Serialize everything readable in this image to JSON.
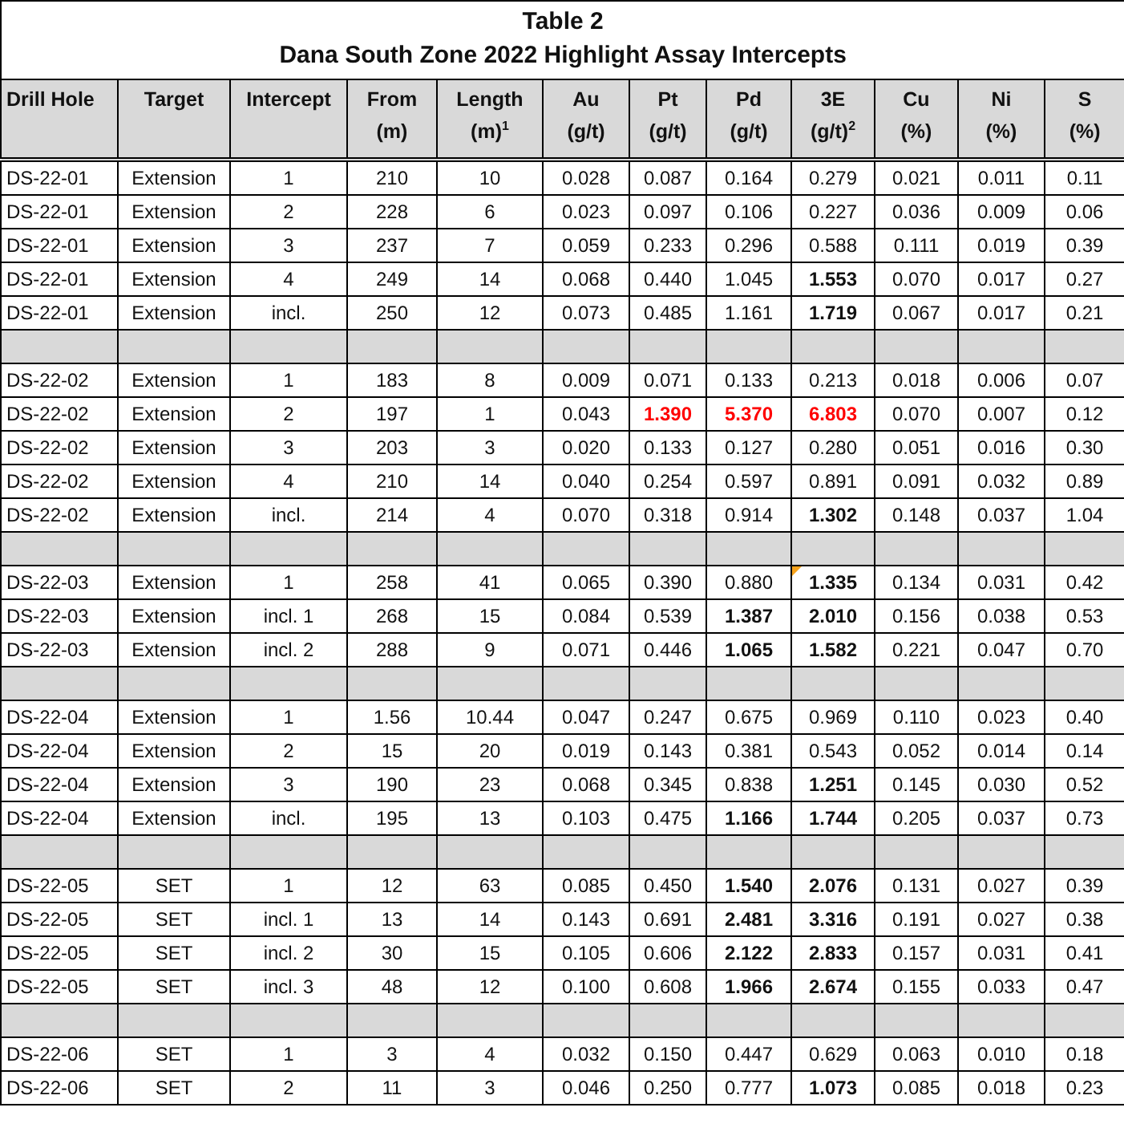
{
  "title": [
    "Table 2",
    "Dana South Zone 2022 Highlight Assay Intercepts"
  ],
  "columns": [
    {
      "name": "Drill Hole"
    },
    {
      "name": "Target"
    },
    {
      "name": "Intercept"
    },
    {
      "name": "From",
      "unit": "(m)"
    },
    {
      "name": "Length",
      "unit": "(m)$^{1}$"
    },
    {
      "name": "Au",
      "unit": "(g/t)"
    },
    {
      "name": "Pt",
      "unit": "(g/t)"
    },
    {
      "name": "Pd",
      "unit": "(g/t)"
    },
    {
      "name": "3E",
      "unit": "(g/t)$^{2}$"
    },
    {
      "name": "Cu",
      "unit": "(%)"
    },
    {
      "name": "Ni",
      "unit": "(%)"
    },
    {
      "name": "S",
      "unit": "(%)"
    }
  ],
  "rows": [
    {
      "kind": "data",
      "cells": [
        {
          "text": "DS-22-01"
        },
        {
          "text": "Extension"
        },
        {
          "text": "1"
        },
        {
          "text": "210"
        },
        {
          "text": "10"
        },
        {
          "text": "0.028"
        },
        {
          "text": "0.087"
        },
        {
          "text": "0.164"
        },
        {
          "text": "0.279"
        },
        {
          "text": "0.021"
        },
        {
          "text": "0.011"
        },
        {
          "text": "0.11"
        }
      ]
    },
    {
      "kind": "data",
      "cells": [
        {
          "text": "DS-22-01"
        },
        {
          "text": "Extension"
        },
        {
          "text": "2"
        },
        {
          "text": "228"
        },
        {
          "text": "6"
        },
        {
          "text": "0.023"
        },
        {
          "text": "0.097"
        },
        {
          "text": "0.106"
        },
        {
          "text": "0.227"
        },
        {
          "text": "0.036"
        },
        {
          "text": "0.009"
        },
        {
          "text": "0.06"
        }
      ]
    },
    {
      "kind": "data",
      "cells": [
        {
          "text": "DS-22-01"
        },
        {
          "text": "Extension"
        },
        {
          "text": "3"
        },
        {
          "text": "237"
        },
        {
          "text": "7"
        },
        {
          "text": "0.059"
        },
        {
          "text": "0.233"
        },
        {
          "text": "0.296"
        },
        {
          "text": "0.588"
        },
        {
          "text": "0.111"
        },
        {
          "text": "0.019"
        },
        {
          "text": "0.39"
        }
      ]
    },
    {
      "kind": "data",
      "cells": [
        {
          "text": "DS-22-01"
        },
        {
          "text": "Extension"
        },
        {
          "text": "4"
        },
        {
          "text": "249"
        },
        {
          "text": "14"
        },
        {
          "text": "0.068"
        },
        {
          "text": "0.440"
        },
        {
          "text": "1.045"
        },
        {
          "text": "1.553",
          "bold": true
        },
        {
          "text": "0.070"
        },
        {
          "text": "0.017"
        },
        {
          "text": "0.27"
        }
      ]
    },
    {
      "kind": "data",
      "cells": [
        {
          "text": "DS-22-01"
        },
        {
          "text": "Extension"
        },
        {
          "text": "incl."
        },
        {
          "text": "250"
        },
        {
          "text": "12"
        },
        {
          "text": "0.073"
        },
        {
          "text": "0.485"
        },
        {
          "text": "1.161"
        },
        {
          "text": "1.719",
          "bold": true
        },
        {
          "text": "0.067"
        },
        {
          "text": "0.017"
        },
        {
          "text": "0.21"
        }
      ]
    },
    {
      "kind": "spacer"
    },
    {
      "kind": "data",
      "cells": [
        {
          "text": "DS-22-02"
        },
        {
          "text": "Extension"
        },
        {
          "text": "1"
        },
        {
          "text": "183"
        },
        {
          "text": "8"
        },
        {
          "text": "0.009"
        },
        {
          "text": "0.071"
        },
        {
          "text": "0.133"
        },
        {
          "text": "0.213"
        },
        {
          "text": "0.018"
        },
        {
          "text": "0.006"
        },
        {
          "text": "0.07"
        }
      ]
    },
    {
      "kind": "data",
      "cells": [
        {
          "text": "DS-22-02"
        },
        {
          "text": "Extension"
        },
        {
          "text": "2"
        },
        {
          "text": "197"
        },
        {
          "text": "1"
        },
        {
          "text": "0.043"
        },
        {
          "text": "1.390",
          "bold": true,
          "red": true
        },
        {
          "text": "5.370",
          "bold": true,
          "red": true
        },
        {
          "text": "6.803",
          "bold": true,
          "red": true
        },
        {
          "text": "0.070"
        },
        {
          "text": "0.007"
        },
        {
          "text": "0.12"
        }
      ]
    },
    {
      "kind": "data",
      "cells": [
        {
          "text": "DS-22-02"
        },
        {
          "text": "Extension"
        },
        {
          "text": "3"
        },
        {
          "text": "203"
        },
        {
          "text": "3"
        },
        {
          "text": "0.020"
        },
        {
          "text": "0.133"
        },
        {
          "text": "0.127"
        },
        {
          "text": "0.280"
        },
        {
          "text": "0.051"
        },
        {
          "text": "0.016"
        },
        {
          "text": "0.30"
        }
      ]
    },
    {
      "kind": "data",
      "cells": [
        {
          "text": "DS-22-02"
        },
        {
          "text": "Extension"
        },
        {
          "text": "4"
        },
        {
          "text": "210"
        },
        {
          "text": "14"
        },
        {
          "text": "0.040"
        },
        {
          "text": "0.254"
        },
        {
          "text": "0.597"
        },
        {
          "text": "0.891"
        },
        {
          "text": "0.091"
        },
        {
          "text": "0.032"
        },
        {
          "text": "0.89"
        }
      ]
    },
    {
      "kind": "data",
      "cells": [
        {
          "text": "DS-22-02"
        },
        {
          "text": "Extension"
        },
        {
          "text": "incl."
        },
        {
          "text": "214"
        },
        {
          "text": "4"
        },
        {
          "text": "0.070"
        },
        {
          "text": "0.318"
        },
        {
          "text": "0.914"
        },
        {
          "text": "1.302",
          "bold": true
        },
        {
          "text": "0.148"
        },
        {
          "text": "0.037"
        },
        {
          "text": "1.04"
        }
      ]
    },
    {
      "kind": "spacer"
    },
    {
      "kind": "data",
      "cells": [
        {
          "text": "DS-22-03"
        },
        {
          "text": "Extension"
        },
        {
          "text": "1"
        },
        {
          "text": "258"
        },
        {
          "text": "41"
        },
        {
          "text": "0.065"
        },
        {
          "text": "0.390"
        },
        {
          "text": "0.880"
        },
        {
          "text": "1.335",
          "bold": true,
          "comment": true
        },
        {
          "text": "0.134"
        },
        {
          "text": "0.031"
        },
        {
          "text": "0.42"
        }
      ]
    },
    {
      "kind": "data",
      "cells": [
        {
          "text": "DS-22-03"
        },
        {
          "text": "Extension"
        },
        {
          "text": "incl. 1"
        },
        {
          "text": "268"
        },
        {
          "text": "15"
        },
        {
          "text": "0.084"
        },
        {
          "text": "0.539"
        },
        {
          "text": "1.387",
          "bold": true
        },
        {
          "text": "2.010",
          "bold": true
        },
        {
          "text": "0.156"
        },
        {
          "text": "0.038"
        },
        {
          "text": "0.53"
        }
      ]
    },
    {
      "kind": "data",
      "cells": [
        {
          "text": "DS-22-03"
        },
        {
          "text": "Extension"
        },
        {
          "text": "incl. 2"
        },
        {
          "text": "288"
        },
        {
          "text": "9"
        },
        {
          "text": "0.071"
        },
        {
          "text": "0.446"
        },
        {
          "text": "1.065",
          "bold": true
        },
        {
          "text": "1.582",
          "bold": true
        },
        {
          "text": "0.221"
        },
        {
          "text": "0.047"
        },
        {
          "text": "0.70"
        }
      ]
    },
    {
      "kind": "spacer"
    },
    {
      "kind": "data",
      "cells": [
        {
          "text": "DS-22-04"
        },
        {
          "text": "Extension"
        },
        {
          "text": "1"
        },
        {
          "text": "1.56"
        },
        {
          "text": "10.44"
        },
        {
          "text": "0.047"
        },
        {
          "text": "0.247"
        },
        {
          "text": "0.675"
        },
        {
          "text": "0.969"
        },
        {
          "text": "0.110"
        },
        {
          "text": "0.023"
        },
        {
          "text": "0.40"
        }
      ]
    },
    {
      "kind": "data",
      "cells": [
        {
          "text": "DS-22-04"
        },
        {
          "text": "Extension"
        },
        {
          "text": "2"
        },
        {
          "text": "15"
        },
        {
          "text": "20"
        },
        {
          "text": "0.019"
        },
        {
          "text": "0.143"
        },
        {
          "text": "0.381"
        },
        {
          "text": "0.543"
        },
        {
          "text": "0.052"
        },
        {
          "text": "0.014"
        },
        {
          "text": "0.14"
        }
      ]
    },
    {
      "kind": "data",
      "cells": [
        {
          "text": "DS-22-04"
        },
        {
          "text": "Extension"
        },
        {
          "text": "3"
        },
        {
          "text": "190"
        },
        {
          "text": "23"
        },
        {
          "text": "0.068"
        },
        {
          "text": "0.345"
        },
        {
          "text": "0.838"
        },
        {
          "text": "1.251",
          "bold": true
        },
        {
          "text": "0.145"
        },
        {
          "text": "0.030"
        },
        {
          "text": "0.52"
        }
      ]
    },
    {
      "kind": "data",
      "cells": [
        {
          "text": "DS-22-04"
        },
        {
          "text": "Extension"
        },
        {
          "text": "incl."
        },
        {
          "text": "195"
        },
        {
          "text": "13"
        },
        {
          "text": "0.103"
        },
        {
          "text": "0.475"
        },
        {
          "text": "1.166",
          "bold": true
        },
        {
          "text": "1.744",
          "bold": true
        },
        {
          "text": "0.205"
        },
        {
          "text": "0.037"
        },
        {
          "text": "0.73"
        }
      ]
    },
    {
      "kind": "spacer"
    },
    {
      "kind": "data",
      "cells": [
        {
          "text": "DS-22-05"
        },
        {
          "text": "SET"
        },
        {
          "text": "1"
        },
        {
          "text": "12"
        },
        {
          "text": "63"
        },
        {
          "text": "0.085"
        },
        {
          "text": "0.450"
        },
        {
          "text": "1.540",
          "bold": true
        },
        {
          "text": "2.076",
          "bold": true
        },
        {
          "text": "0.131"
        },
        {
          "text": "0.027"
        },
        {
          "text": "0.39"
        }
      ]
    },
    {
      "kind": "data",
      "cells": [
        {
          "text": "DS-22-05"
        },
        {
          "text": "SET"
        },
        {
          "text": "incl. 1"
        },
        {
          "text": "13"
        },
        {
          "text": "14"
        },
        {
          "text": "0.143"
        },
        {
          "text": "0.691"
        },
        {
          "text": "2.481",
          "bold": true
        },
        {
          "text": "3.316",
          "bold": true
        },
        {
          "text": "0.191"
        },
        {
          "text": "0.027"
        },
        {
          "text": "0.38"
        }
      ]
    },
    {
      "kind": "data",
      "cells": [
        {
          "text": "DS-22-05"
        },
        {
          "text": "SET"
        },
        {
          "text": "incl. 2"
        },
        {
          "text": "30"
        },
        {
          "text": "15"
        },
        {
          "text": "0.105"
        },
        {
          "text": "0.606"
        },
        {
          "text": "2.122",
          "bold": true
        },
        {
          "text": "2.833",
          "bold": true
        },
        {
          "text": "0.157"
        },
        {
          "text": "0.031"
        },
        {
          "text": "0.41"
        }
      ]
    },
    {
      "kind": "data",
      "cells": [
        {
          "text": "DS-22-05"
        },
        {
          "text": "SET"
        },
        {
          "text": "incl. 3"
        },
        {
          "text": "48"
        },
        {
          "text": "12"
        },
        {
          "text": "0.100"
        },
        {
          "text": "0.608"
        },
        {
          "text": "1.966",
          "bold": true
        },
        {
          "text": "2.674",
          "bold": true
        },
        {
          "text": "0.155"
        },
        {
          "text": "0.033"
        },
        {
          "text": "0.47"
        }
      ]
    },
    {
      "kind": "spacer"
    },
    {
      "kind": "data",
      "cells": [
        {
          "text": "DS-22-06"
        },
        {
          "text": "SET"
        },
        {
          "text": "1"
        },
        {
          "text": "3"
        },
        {
          "text": "4"
        },
        {
          "text": "0.032"
        },
        {
          "text": "0.150"
        },
        {
          "text": "0.447"
        },
        {
          "text": "0.629"
        },
        {
          "text": "0.063"
        },
        {
          "text": "0.010"
        },
        {
          "text": "0.18"
        }
      ]
    },
    {
      "kind": "data",
      "cells": [
        {
          "text": "DS-22-06"
        },
        {
          "text": "SET"
        },
        {
          "text": "2"
        },
        {
          "text": "11"
        },
        {
          "text": "3"
        },
        {
          "text": "0.046"
        },
        {
          "text": "0.250"
        },
        {
          "text": "0.777"
        },
        {
          "text": "1.073",
          "bold": true
        },
        {
          "text": "0.085"
        },
        {
          "text": "0.018"
        },
        {
          "text": "0.23"
        }
      ]
    }
  ]
}
